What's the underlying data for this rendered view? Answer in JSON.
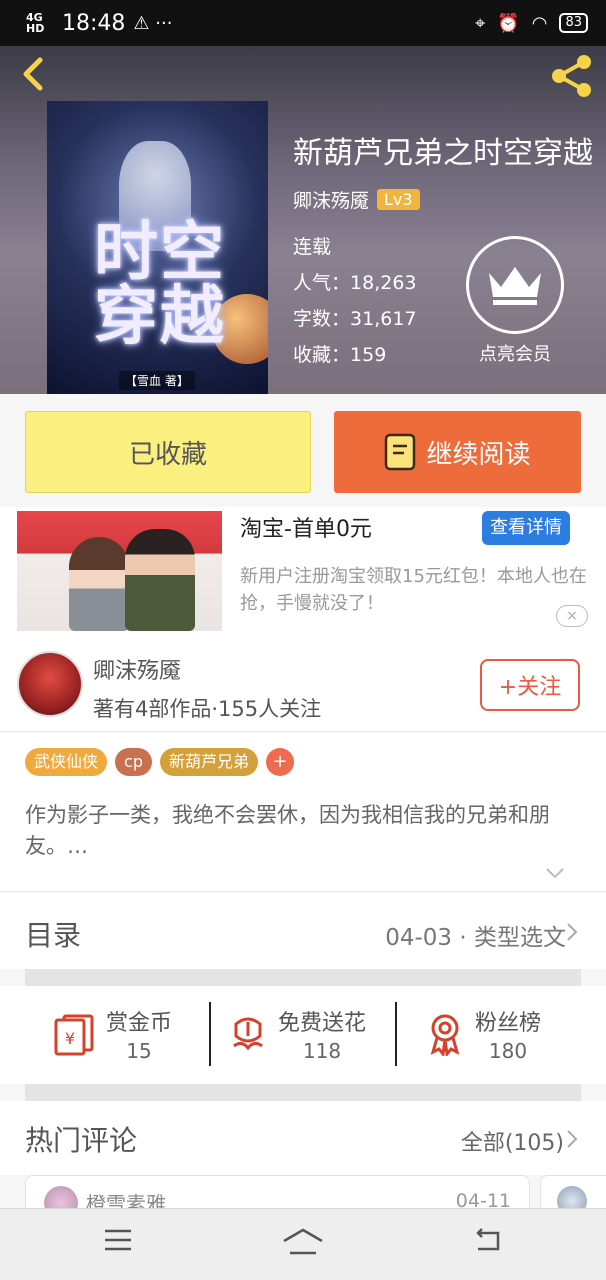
{
  "status_bar": {
    "network": "4G HD",
    "time": "18:48",
    "extra": "⚠ ···",
    "battery": "83"
  },
  "book": {
    "title": "新葫芦兄弟之时空穿越",
    "author": "卿沫殇魇",
    "level": "Lv3",
    "status": "连载",
    "popularity_label": "人气：",
    "popularity": "18,263",
    "words_label": "字数：",
    "words": "31,617",
    "favorites_label": "收藏：",
    "favorites": "159",
    "cover_title": "时空穿越",
    "cover_author_tag": "【雪血 著】"
  },
  "member": {
    "label": "点亮会员"
  },
  "actions": {
    "collected": "已收藏",
    "continue_reading": "继续阅读"
  },
  "ad": {
    "title": "淘宝-首单0元",
    "button": "查看详情",
    "description": "新用户注册淘宝领取15元红包！本地人也在抢，手慢就没了！",
    "close": "×"
  },
  "author_card": {
    "name": "卿沫殇魇",
    "meta": "著有4部作品·155人关注",
    "follow": "+关注"
  },
  "tags": [
    {
      "label": "武侠仙侠",
      "color": "#f2a93b"
    },
    {
      "label": "cp",
      "color": "#c8704f"
    },
    {
      "label": "新葫芦兄弟",
      "color": "#d4a03a"
    }
  ],
  "tag_add": "+",
  "description": "作为影子一类，我绝不会罢休，因为我相信我的兄弟和朋友。…",
  "toc": {
    "label": "目录",
    "update": "04-03 · 类型选文"
  },
  "stats": [
    {
      "title": "赏金币",
      "value": "15",
      "icon": "red-envelope-icon"
    },
    {
      "title": "免费送花",
      "value": "118",
      "icon": "flower-icon"
    },
    {
      "title": "粉丝榜",
      "value": "180",
      "icon": "medal-icon"
    }
  ],
  "comments": {
    "label": "热门评论",
    "all": "全部(105)",
    "first_user": "橙雪素雅",
    "first_date": "04-11"
  },
  "colors": {
    "accent_orange": "#ee6b3c",
    "collected_yellow": "#fbef7f",
    "link_blue": "#2b7de0",
    "icon_red": "#d6412c"
  }
}
